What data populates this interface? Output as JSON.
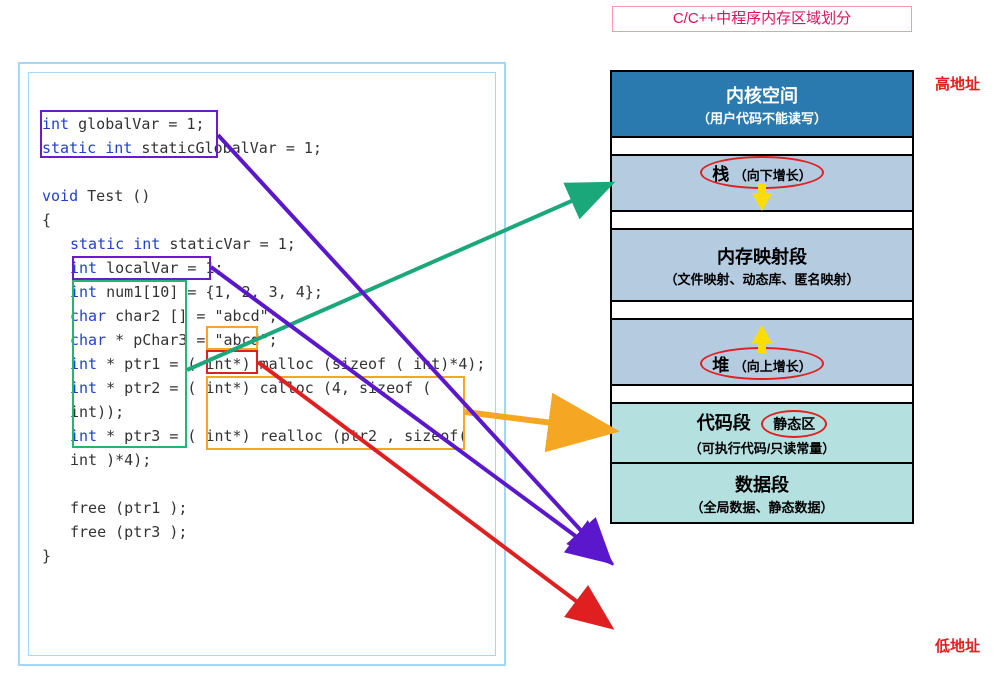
{
  "title": "C/C++中程序内存区域划分",
  "addressLabels": {
    "high": "高地址",
    "low": "低地址"
  },
  "code": {
    "line1_kw": "int",
    "line1_rest": " globalVar           = 1;",
    "line2_kw": "static int",
    "line2_rest": " staticGlobalVar = 1;",
    "line4_kw": "void",
    "line4_rest": " Test ()",
    "line5": "{",
    "line6_kw": "static int",
    "line6_rest": " staticVar = 1;",
    "line7_kw": "int",
    "line7_rest": " localVar    = 1;",
    "line8_kw": "int",
    "line8_rest": " num1[10]  = {1, 2, 3, 4};",
    "line9_kw": "char",
    "line9_rest": " char2 []    = \"abcd\";",
    "line10_kw": "char",
    "line10_rest": " * pChar3  = \"abcd\";",
    "line11_kw": "int",
    "line11_rest": " * ptr1       = ( int*) malloc (sizeof ( int)*4);",
    "line12_kw": "int",
    "line12_rest": " * ptr2       = ( int*) calloc (4, sizeof ( int));",
    "line13_kw": "int",
    "line13_rest": " * ptr3       = ( int*) realloc (ptr2 , sizeof( int )*4);",
    "line15": "free (ptr1 );",
    "line16": "free (ptr3 );",
    "line17": "}"
  },
  "memory": {
    "kernel": {
      "name": "内核空间",
      "sub": "（用户代码不能读写）"
    },
    "stack": {
      "name": "栈",
      "note": "（向下增长）"
    },
    "mmap": {
      "name": "内存映射段",
      "sub": "（文件映射、动态库、匿名映射）"
    },
    "heap": {
      "name": "堆",
      "note": "（向上增长）"
    },
    "code": {
      "name": "代码段",
      "badge": "静态区",
      "sub": "（可执行代码/只读常量）"
    },
    "data": {
      "name": "数据段",
      "sub": "（全局数据、静态数据）"
    }
  },
  "arrows": [
    {
      "from": "green-box",
      "to": "stack",
      "color": "#1aa87a"
    },
    {
      "from": "orange-box",
      "to": "heap",
      "color": "#f5a623"
    },
    {
      "from": "purple-box",
      "to": "code-seg",
      "color": "#5a17cc"
    },
    {
      "from": "red-box",
      "to": "data-seg",
      "color": "#e02020"
    }
  ]
}
